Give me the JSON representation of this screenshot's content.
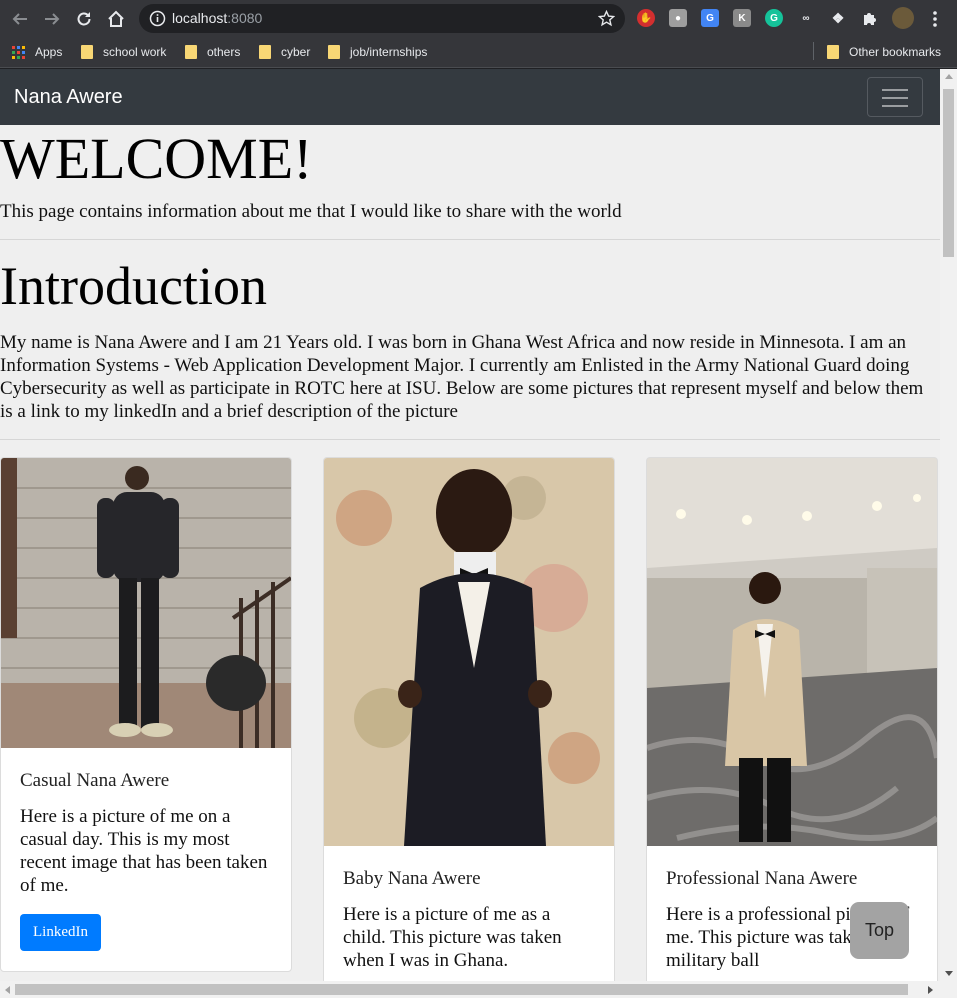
{
  "browser": {
    "url_host": "localhost",
    "url_port": ":8080",
    "bookmarks": [
      "Apps",
      "school work",
      "others",
      "cyber",
      "job/internships"
    ],
    "other_bookmarks": "Other bookmarks",
    "extension_icons": [
      "shield-icon",
      "camera-icon",
      "translate-icon",
      "k-icon",
      "grammarly-icon",
      "glasses-icon",
      "chat-icon",
      "puzzle-icon"
    ]
  },
  "navbar": {
    "brand": "Nana Awere"
  },
  "header": {
    "title": "WELCOME!",
    "lead": "This page contains information about me that I would like to share with the world"
  },
  "intro": {
    "title": "Introduction",
    "text": "My name is Nana Awere and I am 21 Years old. I was born in Ghana West Africa and now reside in Minnesota. I am an Information Systems - Web Application Development Major. I currently am Enlisted in the Army National Guard doing Cybersecurity as well as participate in ROTC here at ISU. Below are some pictures that represent myself and below them is a link to my linkedIn and a brief description of the picture"
  },
  "cards": [
    {
      "title": "Casual Nana Awere",
      "text": "Here is a picture of me on a casual day. This is my most recent image that has been taken of me.",
      "button": "LinkedIn"
    },
    {
      "title": "Baby Nana Awere",
      "text": "Here is a picture of me as a child. This picture was taken when I was in Ghana."
    },
    {
      "title": "Professional Nana Awere",
      "text": "Here is a professional picture of me. This picture was taken at a military ball"
    }
  ],
  "top_button": "Top"
}
